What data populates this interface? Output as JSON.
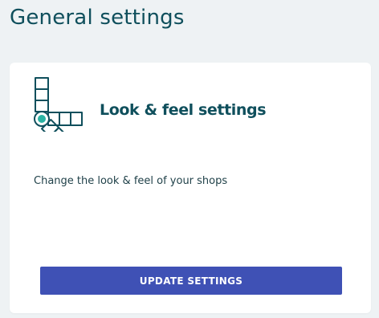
{
  "page": {
    "title": "General settings"
  },
  "card": {
    "icon": "color-swatch-icon",
    "title": "Look & feel settings",
    "description": "Change the look & feel of your shops",
    "button_label": "UPDATE SETTINGS"
  },
  "colors": {
    "title": "#0f4f5c",
    "icon_stroke": "#0f4f5c",
    "icon_accent": "#2bb3a3",
    "button_bg": "#3f51b5",
    "button_text": "#ffffff",
    "page_bg": "#eef2f4",
    "card_bg": "#ffffff"
  }
}
